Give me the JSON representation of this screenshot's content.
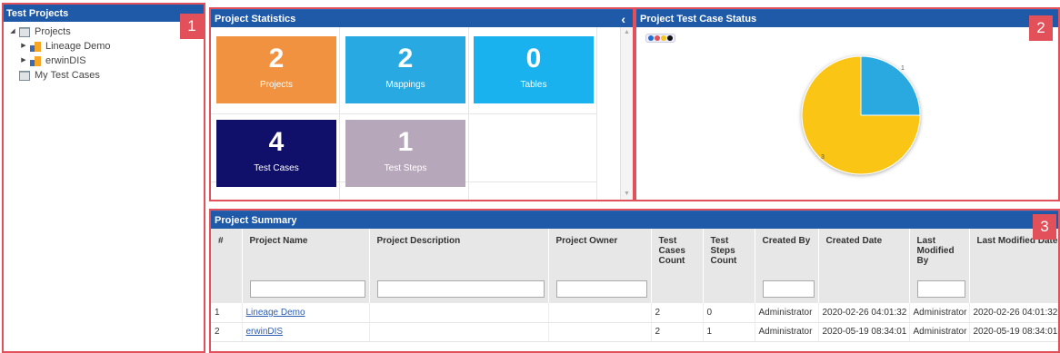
{
  "left_panel": {
    "title": "Test Projects",
    "badge": "1",
    "tree": [
      {
        "label": "Projects"
      },
      {
        "label": "Lineage Demo"
      },
      {
        "label": "erwinDIS"
      },
      {
        "label": "My Test Cases"
      }
    ]
  },
  "stats_panel": {
    "title": "Project Statistics",
    "collapse_glyph": "‹",
    "tiles": [
      {
        "value": "2",
        "label": "Projects",
        "color": "#f0923f"
      },
      {
        "value": "2",
        "label": "Mappings",
        "color": "#29a9e1"
      },
      {
        "value": "0",
        "label": "Tables",
        "color": "#19b2ef"
      },
      {
        "value": "4",
        "label": "Test Cases",
        "color": "#100f6a"
      },
      {
        "value": "1",
        "label": "Test Steps",
        "color": "#b7a7ba"
      }
    ]
  },
  "pie_panel": {
    "title": "Project Test Case Status",
    "badge": "2",
    "legend_colors": [
      "#1f6fd6",
      "#e2505a",
      "#f5c518",
      "#111111"
    ]
  },
  "chart_data": {
    "type": "pie",
    "labels": [
      "1",
      "3"
    ],
    "values": [
      1,
      3
    ],
    "colors": [
      "#29a9e1",
      "#fbc516"
    ]
  },
  "summary_panel": {
    "title": "Project Summary",
    "badge": "3",
    "columns": [
      "#",
      "Project Name",
      "Project Description",
      "Project Owner",
      "Test Cases Count",
      "Test Steps Count",
      "Created By",
      "Created Date",
      "Last Modified By",
      "Last Modified Date"
    ],
    "rows": [
      [
        "1",
        "Lineage Demo",
        "",
        "",
        "2",
        "0",
        "Administrator",
        "2020-02-26 04:01:32",
        "Administrator",
        "2020-02-26 04:01:32"
      ],
      [
        "2",
        "erwinDIS",
        "",
        "",
        "2",
        "1",
        "Administrator",
        "2020-05-19 08:34:01",
        "Administrator",
        "2020-05-19 08:34:01"
      ]
    ]
  }
}
